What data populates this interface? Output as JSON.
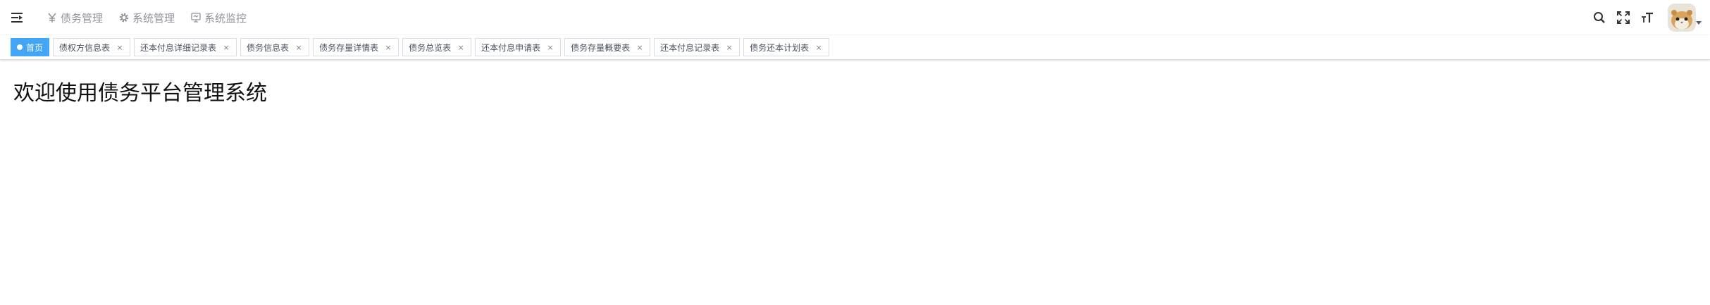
{
  "navbar": {
    "hamburger_icon": "hamburger-icon",
    "menu": [
      {
        "label": "债务管理",
        "icon": "yen-icon"
      },
      {
        "label": "系统管理",
        "icon": "gear-icon"
      },
      {
        "label": "系统监控",
        "icon": "monitor-icon"
      }
    ],
    "right_icons": [
      "search-icon",
      "fullscreen-icon",
      "font-size-icon"
    ],
    "avatar_icon": "avatar"
  },
  "tags": [
    {
      "label": "首页",
      "active": true
    },
    {
      "label": "债权方信息表",
      "close": "×"
    },
    {
      "label": "还本付息详细记录表",
      "close": "×"
    },
    {
      "label": "债务信息表",
      "close": "×"
    },
    {
      "label": "债务存量详情表",
      "close": "×"
    },
    {
      "label": "债务总览表",
      "close": "×"
    },
    {
      "label": "还本付息申请表",
      "close": "×"
    },
    {
      "label": "债务存量概要表",
      "close": "×"
    },
    {
      "label": "还本付息记录表",
      "close": "×"
    },
    {
      "label": "债务还本计划表",
      "close": "×"
    }
  ],
  "main": {
    "welcome_title": "欢迎使用债务平台管理系统"
  },
  "colors": {
    "active_tag": "#42a5f5",
    "menu_text": "#909399",
    "border": "#d8dce5"
  }
}
